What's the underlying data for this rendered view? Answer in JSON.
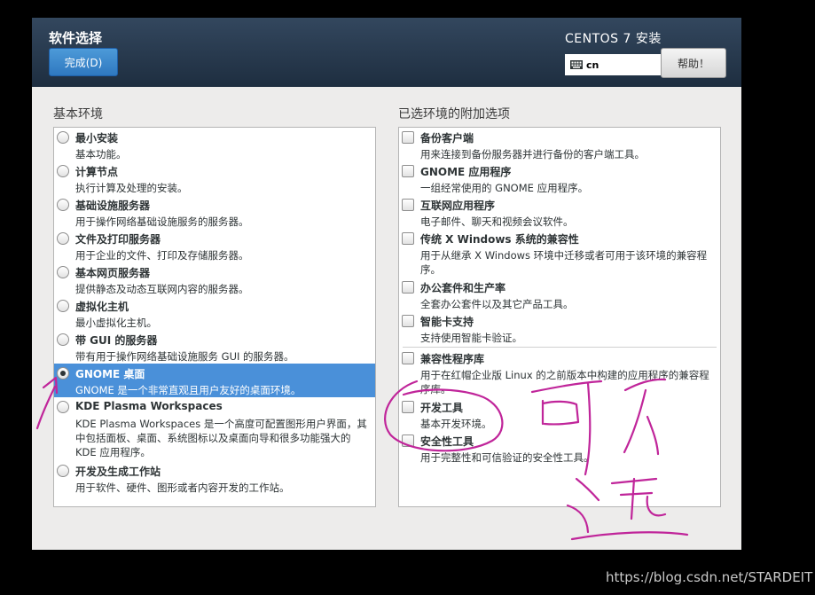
{
  "header": {
    "title": "软件选择",
    "done_label": "完成(D)",
    "product": "CENTOS 7 安装",
    "keyboard_layout": "cn",
    "help_label": "帮助！"
  },
  "left": {
    "heading": "基本环境",
    "items": [
      {
        "name": "最小安装",
        "desc": "基本功能。"
      },
      {
        "name": "计算节点",
        "desc": "执行计算及处理的安装。"
      },
      {
        "name": "基础设施服务器",
        "desc": "用于操作网络基础设施服务的服务器。"
      },
      {
        "name": "文件及打印服务器",
        "desc": "用于企业的文件、打印及存储服务器。"
      },
      {
        "name": "基本网页服务器",
        "desc": "提供静态及动态互联网内容的服务器。"
      },
      {
        "name": "虚拟化主机",
        "desc": "最小虚拟化主机。"
      },
      {
        "name": "带 GUI 的服务器",
        "desc": "带有用于操作网络基础设施服务 GUI 的服务器。"
      },
      {
        "name": "GNOME 桌面",
        "desc": "GNOME 是一个非常直观且用户友好的桌面环境。",
        "selected": true
      },
      {
        "name": "KDE Plasma Workspaces",
        "desc": "KDE Plasma Workspaces 是一个高度可配置图形用户界面，其中包括面板、桌面、系统图标以及桌面向导和很多功能强大的 KDE 应用程序。"
      },
      {
        "name": "开发及生成工作站",
        "desc": "用于软件、硬件、图形或者内容开发的工作站。"
      }
    ]
  },
  "right": {
    "heading": "已选环境的附加选项",
    "items": [
      {
        "name": "备份客户端",
        "desc": "用来连接到备份服务器并进行备份的客户端工具。"
      },
      {
        "name": "GNOME 应用程序",
        "desc": "一组经常使用的 GNOME 应用程序。"
      },
      {
        "name": "互联网应用程序",
        "desc": "电子邮件、聊天和视频会议软件。"
      },
      {
        "name": "传统 X Windows 系统的兼容性",
        "desc": "用于从继承 X Windows 环境中迁移或者可用于该环境的兼容程序。"
      },
      {
        "name": "办公套件和生产率",
        "desc": "全套办公套件以及其它产品工具。"
      },
      {
        "name": "智能卡支持",
        "desc": "支持使用智能卡验证。"
      },
      {
        "name": "兼容性程序库",
        "desc": "用于在红帽企业版 Linux 的之前版本中构建的应用程序的兼容程序库。"
      },
      {
        "name": "开发工具",
        "desc": "基本开发环境。"
      },
      {
        "name": "安全性工具",
        "desc": "用于完整性和可信验证的安全性工具。"
      }
    ]
  },
  "annotation_color": "#c0259a",
  "watermark": "https://blog.csdn.net/STARDEIT"
}
